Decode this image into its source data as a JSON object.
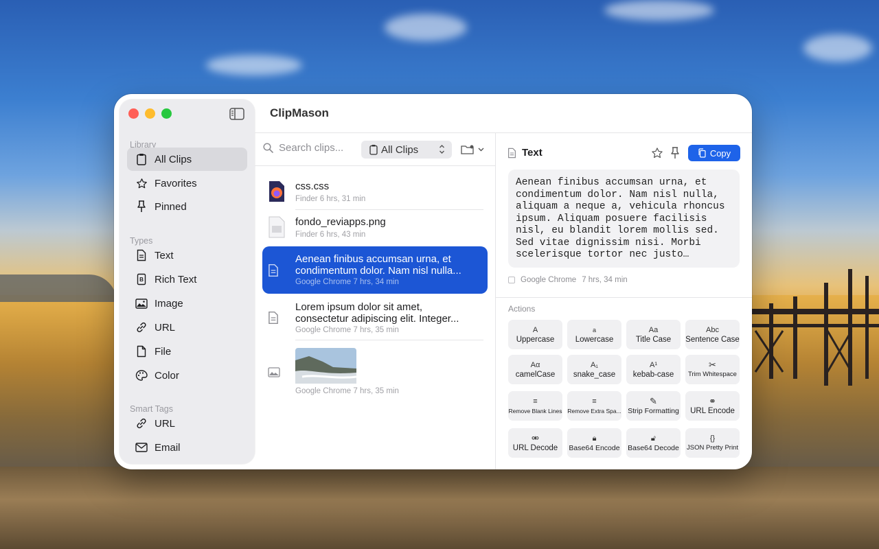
{
  "app": {
    "title": "ClipMason"
  },
  "sidebar": {
    "sections": {
      "library": "Library",
      "types": "Types",
      "smart_tags": "Smart Tags"
    },
    "library_items": [
      {
        "label": "All Clips",
        "icon": "clipboard-icon"
      },
      {
        "label": "Favorites",
        "icon": "star-icon"
      },
      {
        "label": "Pinned",
        "icon": "pin-icon"
      }
    ],
    "type_items": [
      {
        "label": "Text",
        "icon": "document-icon"
      },
      {
        "label": "Rich Text",
        "icon": "rich-text-icon"
      },
      {
        "label": "Image",
        "icon": "image-icon"
      },
      {
        "label": "URL",
        "icon": "link-icon"
      },
      {
        "label": "File",
        "icon": "file-icon"
      },
      {
        "label": "Color",
        "icon": "palette-icon"
      }
    ],
    "smart_tag_items": [
      {
        "label": "URL",
        "icon": "link-icon"
      },
      {
        "label": "Email",
        "icon": "envelope-icon"
      }
    ]
  },
  "list": {
    "search_placeholder": "Search clips...",
    "filter_value": "All Clips",
    "clips": [
      {
        "title": "css.css",
        "meta": "Finder  6 hrs, 31 min",
        "icon": "firefox-file-icon"
      },
      {
        "title": "fondo_reviapps.png",
        "meta": "Finder  6 hrs, 43 min",
        "icon": "png-file-icon"
      },
      {
        "title": "Aenean finibus accumsan urna, et condimentum dolor. Nam nisl nulla...",
        "meta": "Google Chrome  7 hrs, 34 min",
        "icon": "document-icon"
      },
      {
        "title": "Lorem ipsum dolor sit amet, consectetur adipiscing elit. Integer...",
        "meta": "Google Chrome  7 hrs, 35 min",
        "icon": "document-icon"
      },
      {
        "title": "",
        "meta": "Google Chrome  7 hrs, 35 min",
        "icon": "image-icon"
      }
    ]
  },
  "detail": {
    "type_label": "Text",
    "copy_label": "Copy",
    "preview_text": "Aenean finibus accumsan urna, et condimentum dolor. Nam nisl nulla, aliquam a neque a, vehicula rhoncus ipsum. Aliquam posuere facilisis nisl, eu blandit lorem mollis sed. Sed vitae dignissim nisi. Morbi scelerisque tortor nec justo fermentum",
    "source_app": "Google Chrome",
    "source_time": "7 hrs, 34 min",
    "actions_label": "Actions",
    "actions": [
      {
        "icon": "A",
        "label": "Uppercase"
      },
      {
        "icon": "a",
        "label": "Lowercase"
      },
      {
        "icon": "Aa",
        "label": "Title Case"
      },
      {
        "icon": "Abc",
        "label": "Sentence Case"
      },
      {
        "icon": "Aα",
        "label": "camelCase"
      },
      {
        "icon": "A₁",
        "label": "snake_case"
      },
      {
        "icon": "A¹",
        "label": "kebab-case"
      },
      {
        "icon": "✂",
        "label": "Trim Whitespace"
      },
      {
        "icon": "≡",
        "label": "Remove Blank Lines"
      },
      {
        "icon": "≡",
        "label": "Remove Extra Spa..."
      },
      {
        "icon": "✎",
        "label": "Strip Formatting"
      },
      {
        "icon": "⚭",
        "label": "URL Encode"
      },
      {
        "icon": "⚮",
        "label": "URL Decode"
      },
      {
        "icon": "🔒︎",
        "label": "Base64 Encode"
      },
      {
        "icon": "🔓︎",
        "label": "Base64 Decode"
      },
      {
        "icon": "{}",
        "label": "JSON Pretty Print"
      }
    ]
  },
  "colors": {
    "accent": "#1e63e9",
    "selection": "#1c56d5",
    "traffic_red": "#ff5f57",
    "traffic_yellow": "#febc2e",
    "traffic_green": "#28c840"
  }
}
